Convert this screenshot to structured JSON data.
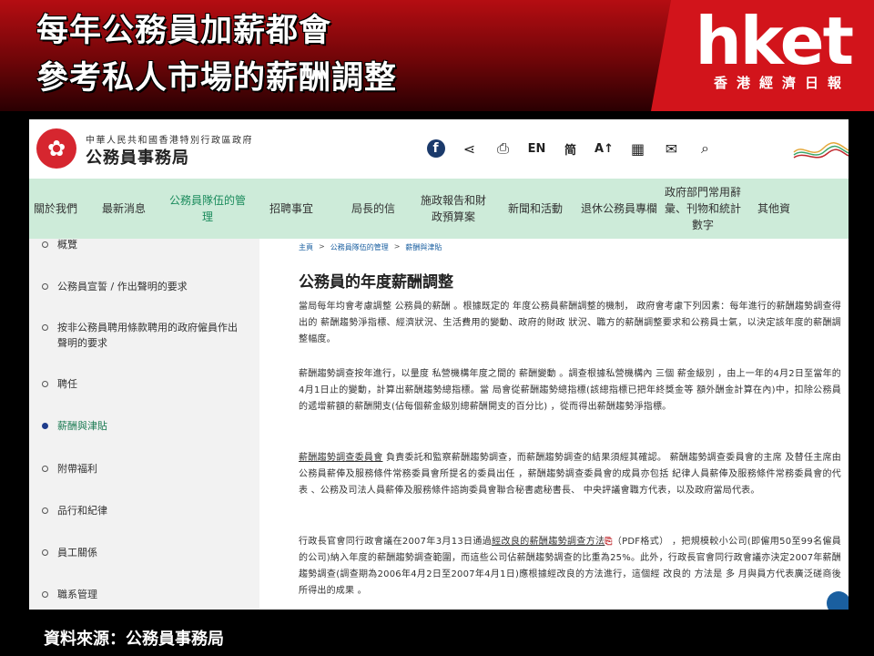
{
  "banner": {
    "title_line1": "每年公務員加薪都會",
    "title_line2": "參考私人市場的薪酬調整",
    "logo_text": "hket",
    "logo_sub": "香港經濟日報"
  },
  "site": {
    "gov_line": "中華人民共和國香港特別行政區政府",
    "dept_name": "公務員事務局",
    "tools": {
      "facebook": "f",
      "share": "⋖",
      "print": "⎙",
      "lang_en": "EN",
      "lang_simplified": "简",
      "font_size": "A↑",
      "qr": "▦",
      "mail": "✉",
      "search": "⌕"
    }
  },
  "nav": {
    "items": [
      {
        "label": "關於我們"
      },
      {
        "label": "最新消息"
      },
      {
        "label": "公務員隊伍的管理",
        "active": true
      },
      {
        "label": "招聘事宜"
      },
      {
        "label": "局長的信"
      },
      {
        "label": "施政報告和財政預算案"
      },
      {
        "label": "新聞和活動"
      },
      {
        "label": "退休公務員專欄"
      },
      {
        "label": "政府部門常用辭彙、刊物和統計數字"
      },
      {
        "label": "其他資"
      }
    ]
  },
  "sidebar": {
    "items": [
      {
        "label": "概覽"
      },
      {
        "label": "公務員宣誓 / 作出聲明的要求"
      },
      {
        "label": "按非公務員聘用條款聘用的政府僱員作出聲明的要求"
      },
      {
        "label": "聘任"
      },
      {
        "label": "薪酬與津貼",
        "active": true
      },
      {
        "label": "附帶福利"
      },
      {
        "label": "品行和紀律"
      },
      {
        "label": "員工關係"
      },
      {
        "label": "職系管理"
      }
    ]
  },
  "content": {
    "breadcrumb": [
      "主頁",
      "公務員隊伍的管理",
      "薪酬與津貼"
    ],
    "breadcrumb_sep": ">",
    "title": "公務員的年度薪酬調整",
    "p1": "當局每年均會考慮調整 公務員的薪酬 。根據既定的 年度公務員薪酬調整的機制， 政府會考慮下列因素：每年進行的薪酬趨勢調查得出的 薪酬趨勢淨指標、經濟狀況、生活費用的變動、政府的財政 狀況、職方的薪酬調整要求和公務員士氣，以決定該年度的薪酬調整幅度。",
    "p2": "薪酬趨勢調查按年進行，以量度 私營機構年度之間的 薪酬變動 。調查根據私營機構內 三個 薪金級別 ，由上一年的4月2日至當年的4月1日止的變動，計算出薪酬趨勢總指標。當 局會從薪酬趨勢總指標(該總指標已把年終獎金等 額外酬金計算在內)中，扣除公務員的遞增薪額的薪酬開支(佔每個薪金級別總薪酬開支的百分比) ，從而得出薪酬趨勢淨指標。",
    "p3_link": "薪酬趨勢調查委員會",
    "p3": " 負責委託和監察薪酬趨勢調查，而薪酬趨勢調查的結果須經其確認。 薪酬趨勢調查委員會的主席 及替任主席由 公務員薪俸及服務條件常務委員會所提名的委員出任 ，薪酬趨勢調查委員會的成員亦包括 紀律人員薪俸及服務條件常務委員會的代表 、公務及司法人員薪俸及服務條件諮詢委員會聯合秘書處秘書長、 中央評議會職方代表，以及政府當局代表。",
    "p4_pre": "行政長官會同行政會議在2007年3月13日通過",
    "p4_link": "經改良的薪酬趨勢調查方法",
    "p4_pdf": "（PDF格式）",
    "p4_post": " ，把規模較小公司(即僱用50至99名僱員的公司)納入年度的薪酬趨勢調查範圍，而這些公司佔薪酬趨勢調查的比重為25%。此外，行政長官會同行政會議亦決定2007年薪酬趨勢調查(調查期為2006年4月2日至2007年4月1日)應根據經改良的方法進行，這個經 改良的 方法是 多 月與員方代表廣泛磋商後所得出的成果 。"
  },
  "source": "資料來源：公務員事務局"
}
